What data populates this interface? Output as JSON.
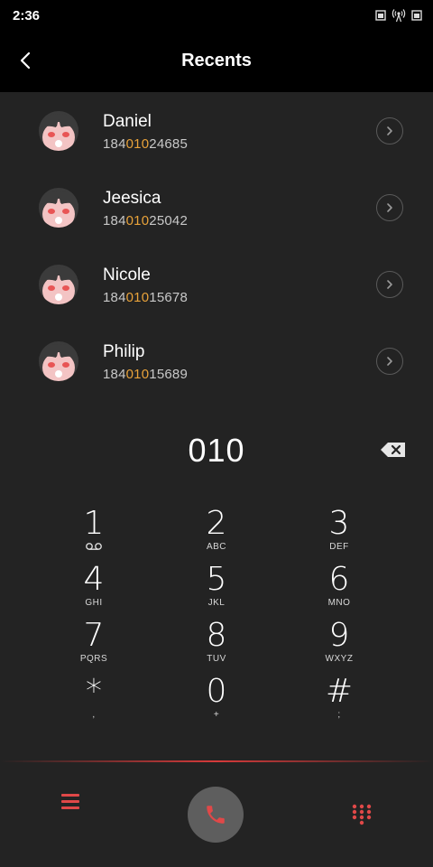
{
  "status_bar": {
    "time": "2:36"
  },
  "header": {
    "title": "Recents"
  },
  "contacts": [
    {
      "name": "Daniel",
      "number_pre": "184",
      "number_match": "010",
      "number_post": "24685"
    },
    {
      "name": "Jeesica",
      "number_pre": "184",
      "number_match": "010",
      "number_post": "25042"
    },
    {
      "name": "Nicole",
      "number_pre": "184",
      "number_match": "010",
      "number_post": "15678"
    },
    {
      "name": "Philip",
      "number_pre": "184",
      "number_match": "010",
      "number_post": "15689"
    }
  ],
  "dialer": {
    "input": "010"
  },
  "keypad": [
    [
      {
        "digit": "1",
        "sub": ""
      },
      {
        "digit": "2",
        "sub": "ABC"
      },
      {
        "digit": "3",
        "sub": "DEF"
      }
    ],
    [
      {
        "digit": "4",
        "sub": "GHI"
      },
      {
        "digit": "5",
        "sub": "JKL"
      },
      {
        "digit": "6",
        "sub": "MNO"
      }
    ],
    [
      {
        "digit": "7",
        "sub": "PQRS"
      },
      {
        "digit": "8",
        "sub": "TUV"
      },
      {
        "digit": "9",
        "sub": "WXYZ"
      }
    ],
    [
      {
        "digit": "*",
        "sub": ","
      },
      {
        "digit": "0",
        "sub": "+"
      },
      {
        "digit": "#",
        "sub": ";"
      }
    ]
  ],
  "icons": {
    "back": "chevron-left-icon",
    "detail": "chevron-right-icon",
    "backspace": "backspace-icon",
    "voicemail": "voicemail-icon",
    "menu": "menu-icon",
    "call": "phone-icon",
    "keypad_toggle": "dialpad-icon"
  },
  "colors": {
    "accent": "#e04848",
    "match_highlight": "#e8a23a",
    "background": "#232323",
    "header_bg": "#000000"
  }
}
